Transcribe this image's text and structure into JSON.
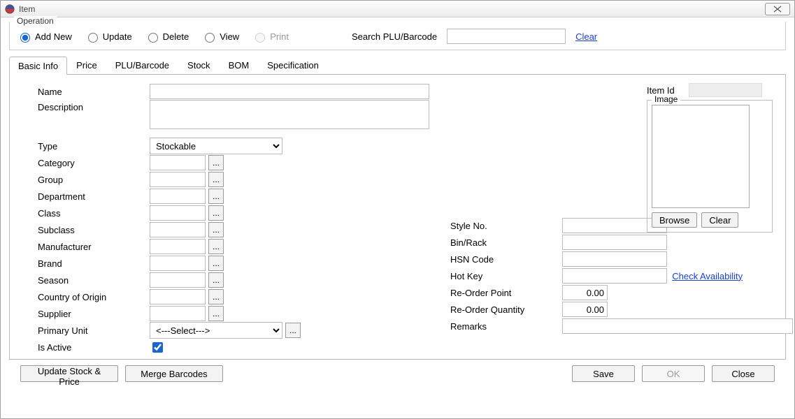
{
  "window": {
    "title": "Item"
  },
  "operation": {
    "legend": "Operation",
    "options": {
      "addnew": "Add New",
      "update": "Update",
      "delete": "Delete",
      "view": "View",
      "print": "Print"
    },
    "search_label": "Search PLU/Barcode",
    "search_value": "",
    "clear_link": "Clear"
  },
  "tabs": {
    "basic": "Basic Info",
    "price": "Price",
    "plu": "PLU/Barcode",
    "stock": "Stock",
    "bom": "BOM",
    "spec": "Specification"
  },
  "form": {
    "name_label": "Name",
    "name_value": "",
    "desc_label": "Description",
    "desc_value": "",
    "type_label": "Type",
    "type_value": "Stockable",
    "category_label": "Category",
    "category_value": "",
    "group_label": "Group",
    "group_value": "",
    "department_label": "Department",
    "department_value": "",
    "class_label": "Class",
    "class_value": "",
    "subclass_label": "Subclass",
    "subclass_value": "",
    "manufacturer_label": "Manufacturer",
    "manufacturer_value": "",
    "brand_label": "Brand",
    "brand_value": "",
    "season_label": "Season",
    "season_value": "",
    "country_label": "Country of Origin",
    "country_value": "",
    "supplier_label": "Supplier",
    "supplier_value": "",
    "primary_unit_label": "Primary Unit",
    "primary_unit_value": "<---Select--->",
    "is_active_label": "Is Active",
    "lookup_dots": "..."
  },
  "mid": {
    "style_label": "Style No.",
    "style_value": "",
    "bin_label": "Bin/Rack",
    "bin_value": "",
    "hsn_label": "HSN Code",
    "hsn_value": "",
    "hotkey_label": "Hot Key",
    "hotkey_value": "",
    "check_avail": "Check Availability",
    "reorder_point_label": "Re-Order Point",
    "reorder_point_value": "0.00",
    "reorder_qty_label": "Re-Order Quantity",
    "reorder_qty_value": "0.00",
    "remarks_label": "Remarks",
    "remarks_value": ""
  },
  "right": {
    "item_id_label": "Item Id",
    "item_id_value": "",
    "image_legend": "Image",
    "browse": "Browse",
    "clear": "Clear"
  },
  "buttons": {
    "update_stock": "Update Stock & Price",
    "merge": "Merge Barcodes",
    "save": "Save",
    "ok": "OK",
    "close": "Close"
  }
}
